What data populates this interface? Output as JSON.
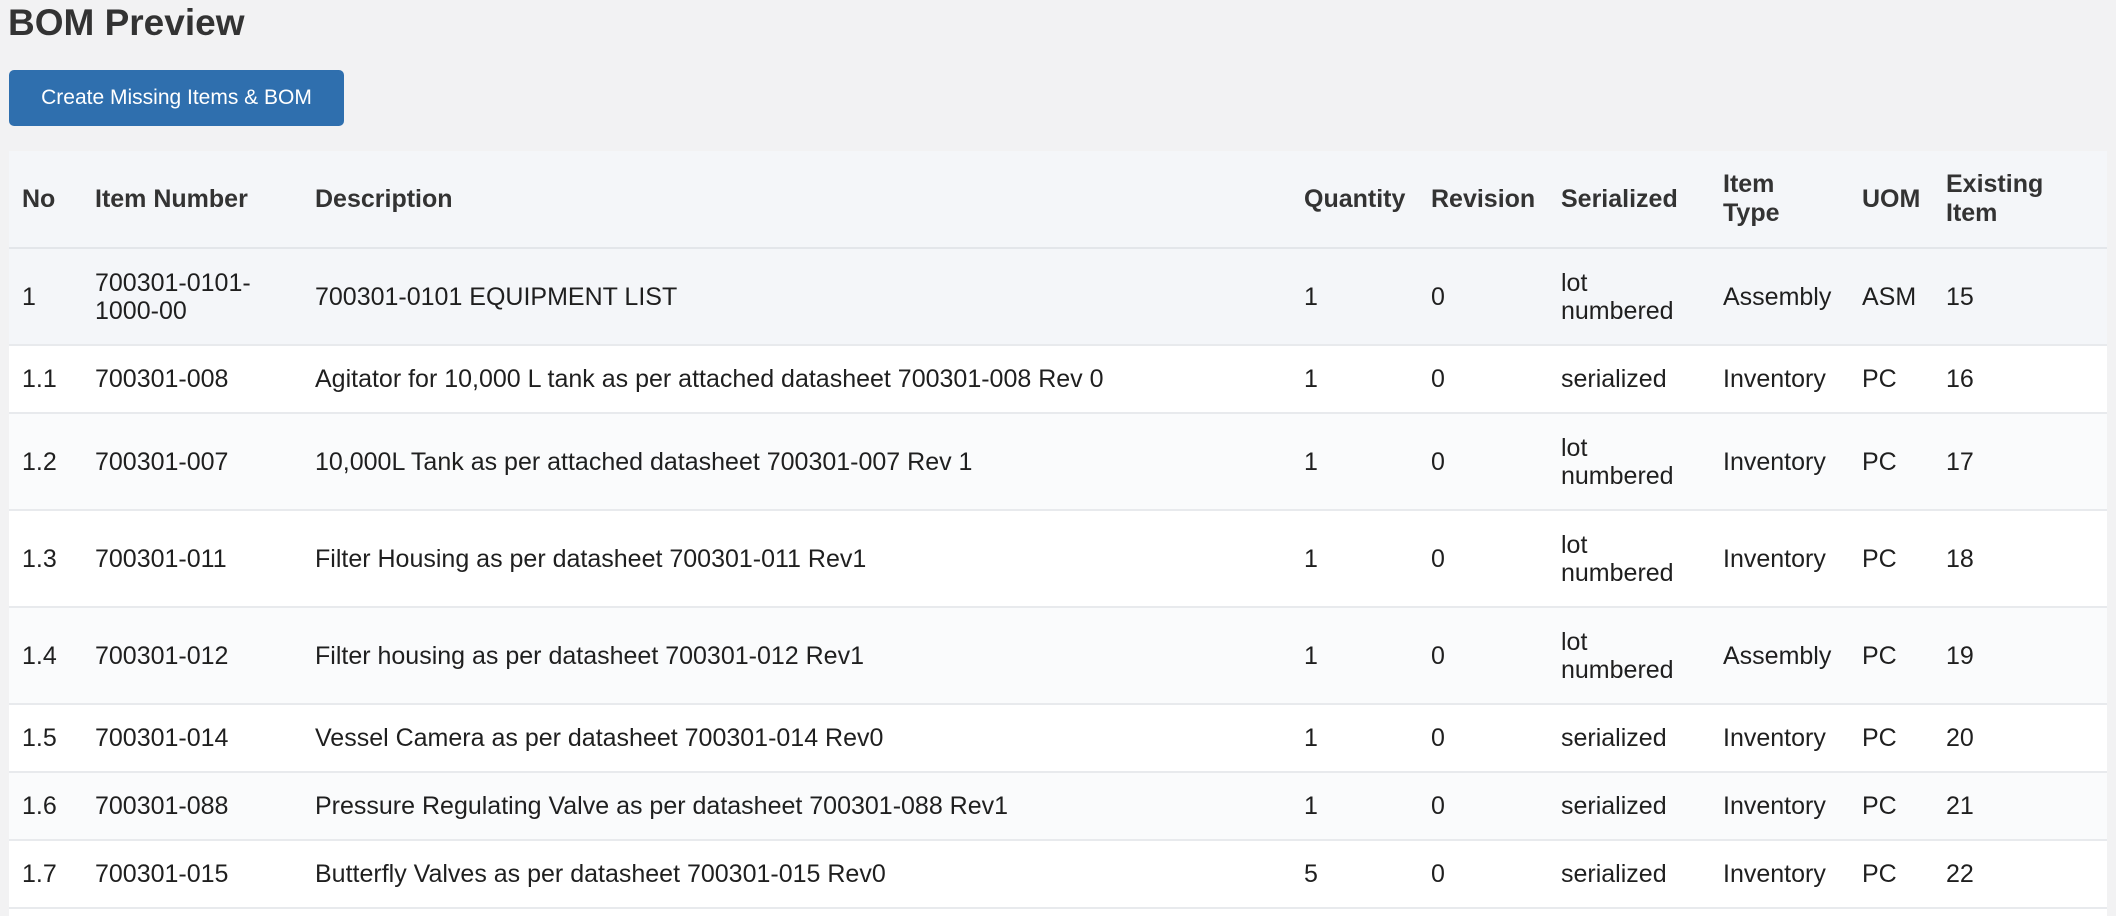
{
  "page": {
    "title": "BOM Preview",
    "create_button_label": "Create Missing Items & BOM"
  },
  "table": {
    "columns": [
      "No",
      "Item Number",
      "Description",
      "Quantity",
      "Revision",
      "Serialized",
      "Item Type",
      "UOM",
      "Existing Item"
    ],
    "rows": [
      {
        "no": "1",
        "item_number": "700301-0101-1000-00",
        "description": "700301-0101 EQUIPMENT LIST",
        "quantity": "1",
        "revision": "0",
        "serialized": "lot numbered",
        "item_type": "Assembly",
        "uom": "ASM",
        "existing_item": "15"
      },
      {
        "no": "1.1",
        "item_number": "700301-008",
        "description": "Agitator for 10,000 L tank as per attached datasheet 700301-008 Rev 0",
        "quantity": "1",
        "revision": "0",
        "serialized": "serialized",
        "item_type": "Inventory",
        "uom": "PC",
        "existing_item": "16"
      },
      {
        "no": "1.2",
        "item_number": "700301-007",
        "description": "10,000L Tank as per attached datasheet 700301-007 Rev 1",
        "quantity": "1",
        "revision": "0",
        "serialized": "lot numbered",
        "item_type": "Inventory",
        "uom": "PC",
        "existing_item": "17"
      },
      {
        "no": "1.3",
        "item_number": "700301-011",
        "description": "Filter Housing as per datasheet 700301-011 Rev1",
        "quantity": "1",
        "revision": "0",
        "serialized": "lot numbered",
        "item_type": "Inventory",
        "uom": "PC",
        "existing_item": "18"
      },
      {
        "no": "1.4",
        "item_number": "700301-012",
        "description": "Filter housing as per datasheet 700301-012 Rev1",
        "quantity": "1",
        "revision": "0",
        "serialized": "lot numbered",
        "item_type": "Assembly",
        "uom": "PC",
        "existing_item": "19"
      },
      {
        "no": "1.5",
        "item_number": "700301-014",
        "description": "Vessel Camera as per datasheet 700301-014 Rev0",
        "quantity": "1",
        "revision": "0",
        "serialized": "serialized",
        "item_type": "Inventory",
        "uom": "PC",
        "existing_item": "20"
      },
      {
        "no": "1.6",
        "item_number": "700301-088",
        "description": "Pressure Regulating Valve as per datasheet 700301-088 Rev1",
        "quantity": "1",
        "revision": "0",
        "serialized": "serialized",
        "item_type": "Inventory",
        "uom": "PC",
        "existing_item": "21"
      },
      {
        "no": "1.7",
        "item_number": "700301-015",
        "description": "Butterfly Valves as per datasheet 700301-015 Rev0",
        "quantity": "5",
        "revision": "0",
        "serialized": "serialized",
        "item_type": "Inventory",
        "uom": "PC",
        "existing_item": "22"
      }
    ]
  }
}
